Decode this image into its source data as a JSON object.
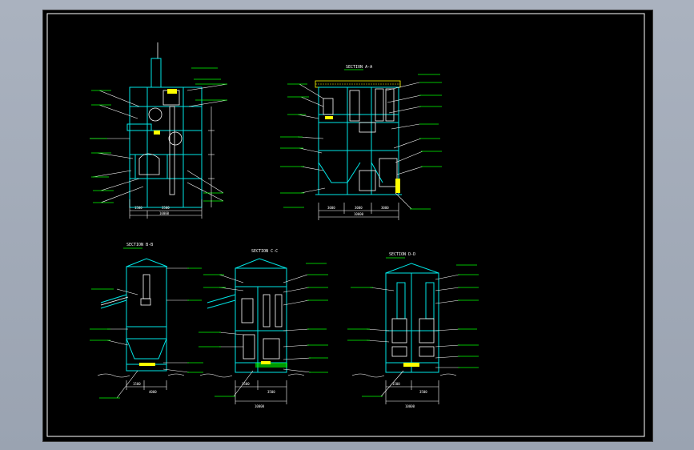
{
  "drawing": {
    "colors": {
      "background": "#000000",
      "frame": "#ffffff",
      "structure": "#00e6e6",
      "equipment": "#ffffff",
      "leader": "#ffffff",
      "tag_line": "#00ff00",
      "highlight": "#ffff00",
      "dimension": "#ffffff",
      "accent": "#ff3030"
    },
    "views": [
      {
        "id": "elevation-1",
        "title": ""
      },
      {
        "id": "section-a-a",
        "title": "SECTION A-A"
      },
      {
        "id": "section-b-b",
        "title": "SECTION B-B"
      },
      {
        "id": "section-c-c",
        "title": "SECTION C-C"
      },
      {
        "id": "section-d-d",
        "title": "SECTION D-D"
      }
    ],
    "dimensions": {
      "elevation_1_bottom": [
        "1500",
        "3500",
        "10000"
      ],
      "section_a_bottom": [
        "3000",
        "3000",
        "3000",
        "10000"
      ],
      "section_b_bottom": [
        "1500",
        "4000"
      ],
      "section_c_bottom": [
        "1500",
        "3500",
        "10000"
      ],
      "section_d_bottom": [
        "1500",
        "3500",
        "10000"
      ]
    }
  }
}
